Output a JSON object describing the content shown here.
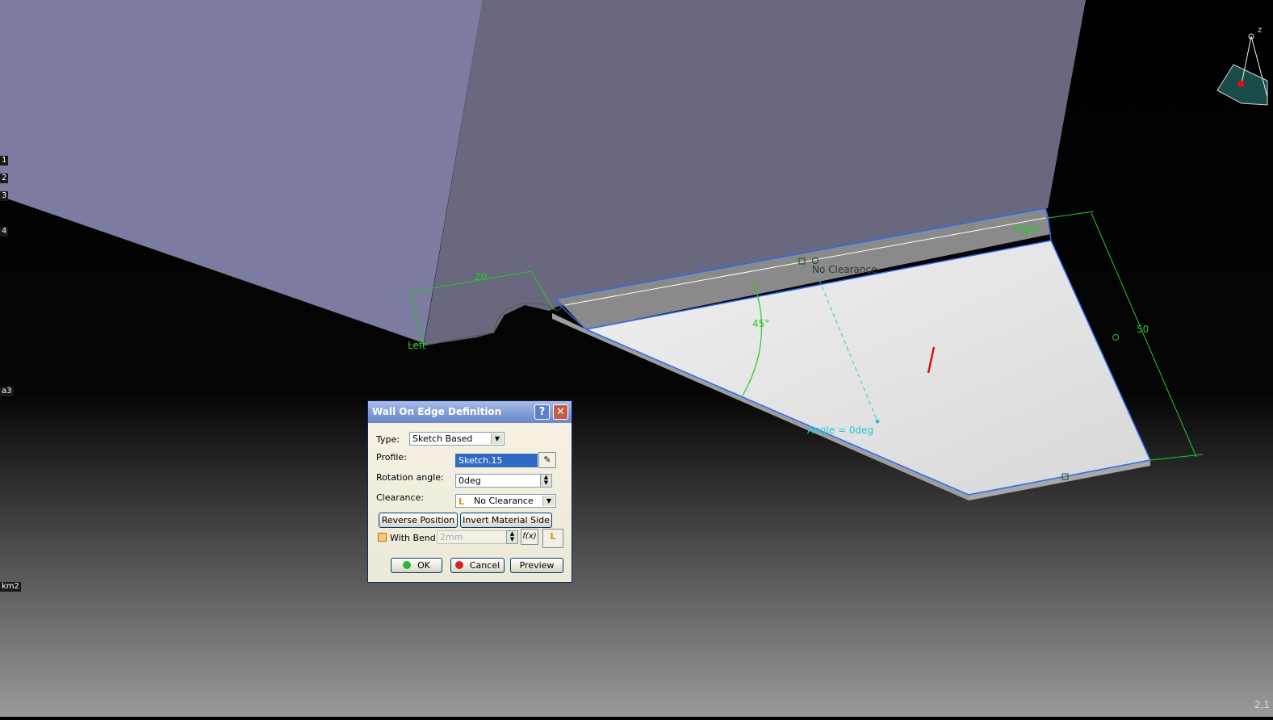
{
  "viewport": {
    "labels": {
      "left": "Left",
      "right": "Right",
      "clearance": "No Clearance",
      "angle_45": "45°",
      "dim_20": "20",
      "dim_50": "50",
      "angle_zero": "Angle = 0deg"
    },
    "compass_axis": "z",
    "tree_tags": [
      "1",
      "2",
      "3",
      "4",
      "a3",
      "km2"
    ],
    "coord_readout": "2,1"
  },
  "dialog": {
    "title": "Wall On Edge Definition",
    "help_glyph": "?",
    "close_glyph": "✕",
    "type_label": "Type:",
    "type_value": "Sketch Based",
    "profile_label": "Profile:",
    "profile_value": "Sketch.15",
    "rotation_label": "Rotation angle:",
    "rotation_value": "0deg",
    "clearance_label": "Clearance:",
    "clearance_value": "No Clearance",
    "reverse_position": "Reverse Position",
    "invert_material_side": "Invert Material Side",
    "with_bend_label": "With Bend",
    "with_bend_checked": false,
    "bend_radius_placeholder": "2mm",
    "fx_label": "f(x)",
    "ok_label": "OK",
    "cancel_label": "Cancel",
    "preview_label": "Preview"
  },
  "colors": {
    "accent_blue": "#1f5fe6",
    "dimension_green": "#22cc22",
    "annotation_cyan": "#20c8d8",
    "ok_green": "#2fb52f",
    "cancel_red": "#d32626"
  }
}
